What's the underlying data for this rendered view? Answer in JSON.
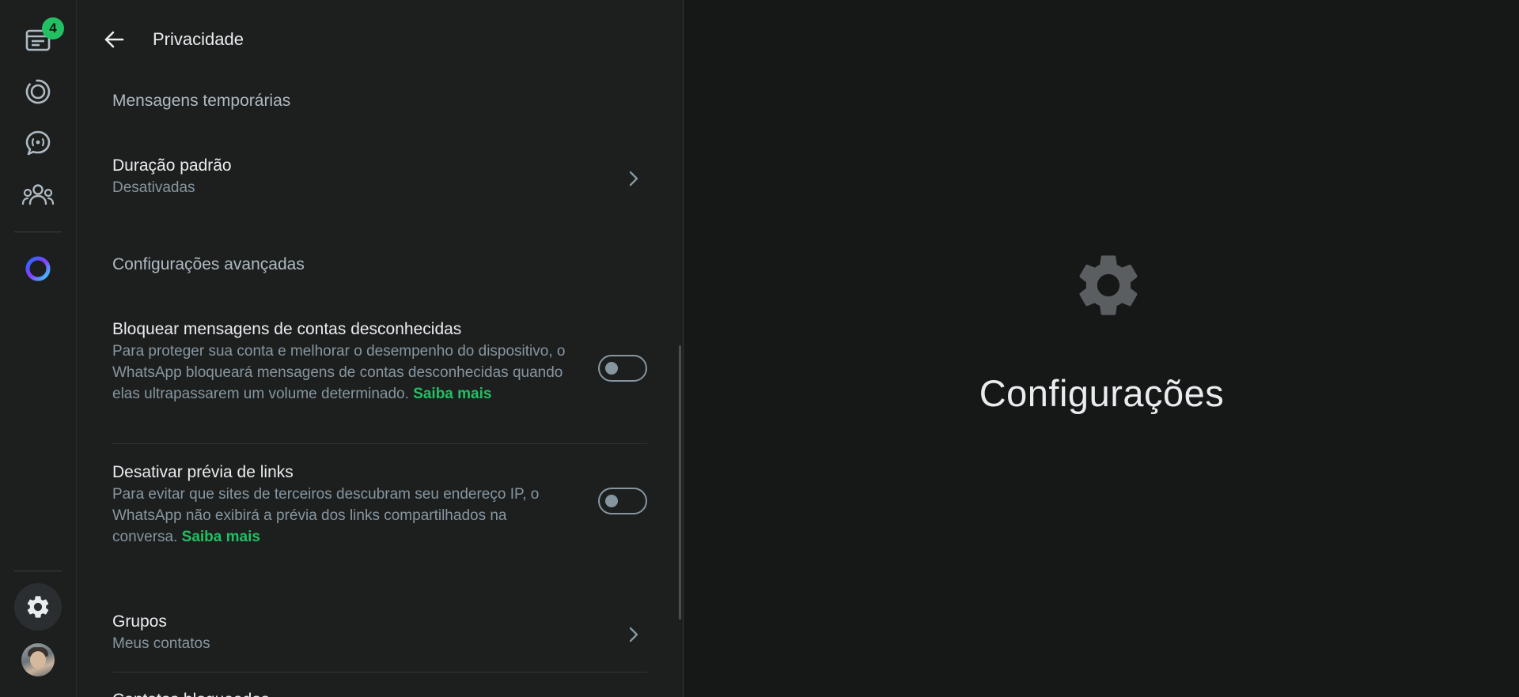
{
  "rail": {
    "chats_badge": "4",
    "icons": [
      "chats-icon",
      "status-icon",
      "channels-icon",
      "communities-icon",
      "meta-ai-icon",
      "settings-icon",
      "profile-avatar"
    ]
  },
  "panel": {
    "title": "Privacidade",
    "section_disappearing": "Mensagens temporárias",
    "default_duration": {
      "label": "Duração padrão",
      "value": "Desativadas"
    },
    "section_advanced": "Configurações avançadas",
    "block_unknown": {
      "label": "Bloquear mensagens de contas desconhecidas",
      "desc": "Para proteger sua conta e melhorar o desempenho do dispositivo, o WhatsApp bloqueará mensagens de contas desconhecidas quando elas ultrapassarem um volume determinado.",
      "link": "Saiba mais",
      "enabled": false
    },
    "disable_link_preview": {
      "label": "Desativar prévia de links",
      "desc": "Para evitar que sites de terceiros descubram seu endereço IP, o WhatsApp não exibirá a prévia dos links compartilhados na conversa.",
      "link": "Saiba mais",
      "enabled": false
    },
    "groups": {
      "label": "Grupos",
      "value": "Meus contatos"
    },
    "blocked_contacts": {
      "label": "Contatos bloqueados"
    }
  },
  "main": {
    "title": "Configurações"
  },
  "colors": {
    "accent": "#21c063",
    "background": "#1d1f1f",
    "main_background": "#161717",
    "text_primary": "#e9edef",
    "text_secondary": "#8696a0"
  }
}
